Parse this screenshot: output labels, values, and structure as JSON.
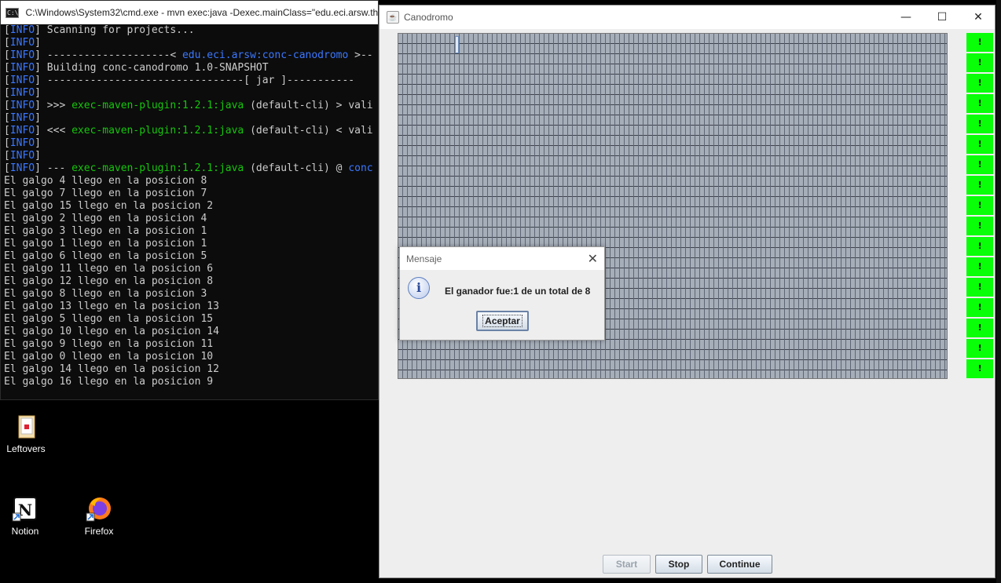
{
  "cmd": {
    "title": "C:\\Windows\\System32\\cmd.exe - mvn  exec:java -Dexec.mainClass=\"edu.eci.arsw.th",
    "lines": [
      [
        {
          "t": "[",
          "c": ""
        },
        {
          "t": "INFO",
          "c": "info"
        },
        {
          "t": "] Scanning for projects...",
          "c": ""
        }
      ],
      [
        {
          "t": "[",
          "c": ""
        },
        {
          "t": "INFO",
          "c": "info"
        },
        {
          "t": "]",
          "c": ""
        }
      ],
      [
        {
          "t": "[",
          "c": ""
        },
        {
          "t": "INFO",
          "c": "info"
        },
        {
          "t": "] --------------------< ",
          "c": ""
        },
        {
          "t": "edu.eci.arsw:conc-canodromo",
          "c": "blu"
        },
        {
          "t": " >--",
          "c": ""
        }
      ],
      [
        {
          "t": "[",
          "c": ""
        },
        {
          "t": "INFO",
          "c": "info"
        },
        {
          "t": "] Building conc-canodromo 1.0-SNAPSHOT",
          "c": ""
        }
      ],
      [
        {
          "t": "[",
          "c": ""
        },
        {
          "t": "INFO",
          "c": "info"
        },
        {
          "t": "] --------------------------------[ jar ]-----------",
          "c": ""
        }
      ],
      [
        {
          "t": "[",
          "c": ""
        },
        {
          "t": "INFO",
          "c": "info"
        },
        {
          "t": "]",
          "c": ""
        }
      ],
      [
        {
          "t": "[",
          "c": ""
        },
        {
          "t": "INFO",
          "c": "info"
        },
        {
          "t": "] >>> ",
          "c": ""
        },
        {
          "t": "exec-maven-plugin:1.2.1:java",
          "c": "grn"
        },
        {
          "t": " (default-cli) > vali",
          "c": ""
        }
      ],
      [
        {
          "t": "[",
          "c": ""
        },
        {
          "t": "INFO",
          "c": "info"
        },
        {
          "t": "]",
          "c": ""
        }
      ],
      [
        {
          "t": "[",
          "c": ""
        },
        {
          "t": "INFO",
          "c": "info"
        },
        {
          "t": "] <<< ",
          "c": ""
        },
        {
          "t": "exec-maven-plugin:1.2.1:java",
          "c": "grn"
        },
        {
          "t": " (default-cli) < vali",
          "c": ""
        }
      ],
      [
        {
          "t": "[",
          "c": ""
        },
        {
          "t": "INFO",
          "c": "info"
        },
        {
          "t": "]",
          "c": ""
        }
      ],
      [
        {
          "t": "[",
          "c": ""
        },
        {
          "t": "INFO",
          "c": "info"
        },
        {
          "t": "]",
          "c": ""
        }
      ],
      [
        {
          "t": "[",
          "c": ""
        },
        {
          "t": "INFO",
          "c": "info"
        },
        {
          "t": "] --- ",
          "c": ""
        },
        {
          "t": "exec-maven-plugin:1.2.1:java",
          "c": "grn"
        },
        {
          "t": " (default-cli) @ ",
          "c": ""
        },
        {
          "t": "conc",
          "c": "blu"
        }
      ],
      [
        {
          "t": "El galgo 4 llego en la posicion 8",
          "c": ""
        }
      ],
      [
        {
          "t": "El galgo 7 llego en la posicion 7",
          "c": ""
        }
      ],
      [
        {
          "t": "El galgo 15 llego en la posicion 2",
          "c": ""
        }
      ],
      [
        {
          "t": "El galgo 2 llego en la posicion 4",
          "c": ""
        }
      ],
      [
        {
          "t": "El galgo 3 llego en la posicion 1",
          "c": ""
        }
      ],
      [
        {
          "t": "El galgo 1 llego en la posicion 1",
          "c": ""
        }
      ],
      [
        {
          "t": "El galgo 6 llego en la posicion 5",
          "c": ""
        }
      ],
      [
        {
          "t": "El galgo 11 llego en la posicion 6",
          "c": ""
        }
      ],
      [
        {
          "t": "El galgo 12 llego en la posicion 8",
          "c": ""
        }
      ],
      [
        {
          "t": "El galgo 8 llego en la posicion 3",
          "c": ""
        }
      ],
      [
        {
          "t": "El galgo 13 llego en la posicion 13",
          "c": ""
        }
      ],
      [
        {
          "t": "El galgo 5 llego en la posicion 15",
          "c": ""
        }
      ],
      [
        {
          "t": "El galgo 10 llego en la posicion 14",
          "c": ""
        }
      ],
      [
        {
          "t": "El galgo 9 llego en la posicion 11",
          "c": ""
        }
      ],
      [
        {
          "t": "El galgo 0 llego en la posicion 10",
          "c": ""
        }
      ],
      [
        {
          "t": "El galgo 14 llego en la posicion 12",
          "c": ""
        }
      ],
      [
        {
          "t": "El galgo 16 llego en la posicion 9",
          "c": ""
        }
      ]
    ]
  },
  "desktop": {
    "leftovers": "Leftovers",
    "notion": "Notion",
    "firefox": "Firefox"
  },
  "app": {
    "title": "Canodromo",
    "window_controls": {
      "minimize": "—",
      "maximize": "☐",
      "close": "✕"
    },
    "lights": [
      "!",
      "!",
      "!",
      "!",
      "!",
      "!",
      "!",
      "!",
      "!",
      "!",
      "!",
      "!",
      "!",
      "!",
      "!",
      "!",
      "!"
    ],
    "light_color": "#08ff08",
    "buttons": {
      "start": "Start",
      "stop": "Stop",
      "continue": "Continue"
    }
  },
  "dialog": {
    "title": "Mensaje",
    "close": "✕",
    "icon": "i",
    "message": "El ganador fue:1 de un total de 8",
    "ok": "Aceptar"
  }
}
